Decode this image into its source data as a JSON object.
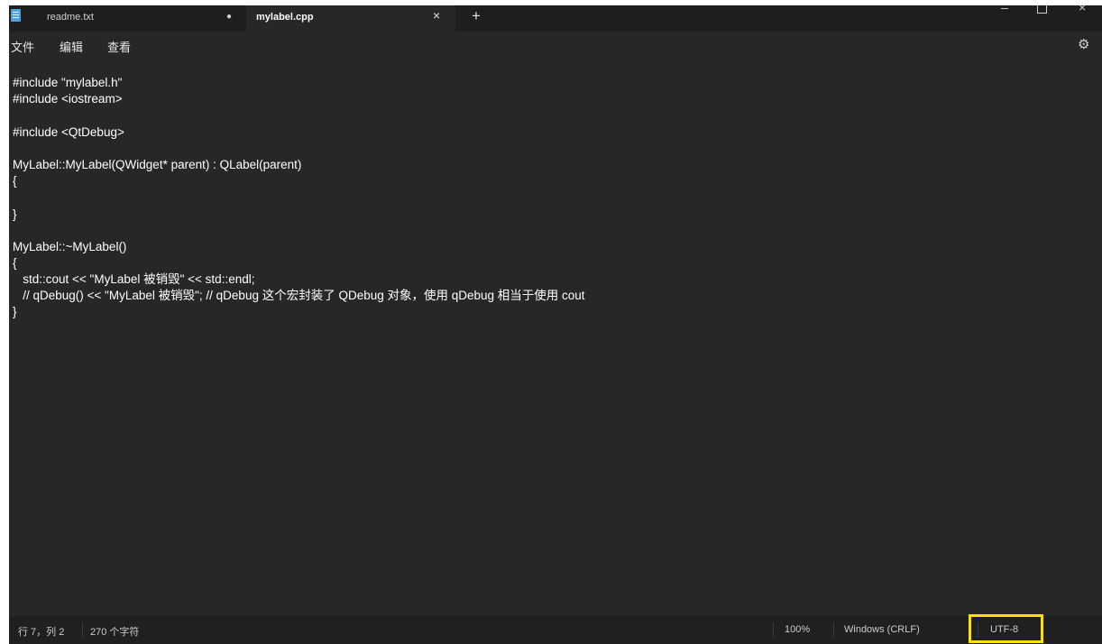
{
  "tabs": [
    {
      "title": "readme.txt",
      "modified_marker": "●"
    },
    {
      "title": "mylabel.cpp",
      "close": "×"
    }
  ],
  "new_tab": "+",
  "window_controls": {
    "minimize": "–",
    "maximize": "□",
    "close": "×"
  },
  "menu": {
    "file": "文件",
    "edit": "编辑",
    "view": "查看"
  },
  "settings_icon": "⚙",
  "code_lines": [
    "#include \"mylabel.h\"",
    "#include <iostream>",
    "",
    "#include <QtDebug>",
    "",
    "MyLabel::MyLabel(QWidget* parent) : QLabel(parent)",
    "{",
    "",
    "}",
    "",
    "MyLabel::~MyLabel()",
    "{",
    "   std::cout << \"MyLabel 被销毁\" << std::endl;",
    "   // qDebug() << \"MyLabel 被销毁\"; // qDebug 这个宏封装了 QDebug 对象，使用 qDebug 相当于使用 cout",
    "}"
  ],
  "status": {
    "position": "行 7，列 2",
    "char_count": "270 个字符",
    "zoom": "100%",
    "line_ending": "Windows (CRLF)",
    "encoding": "UTF-8"
  },
  "colors": {
    "editor_bg": "#272727",
    "tabbar_bg": "#1e1e1e",
    "highlight": "#ffe000"
  }
}
